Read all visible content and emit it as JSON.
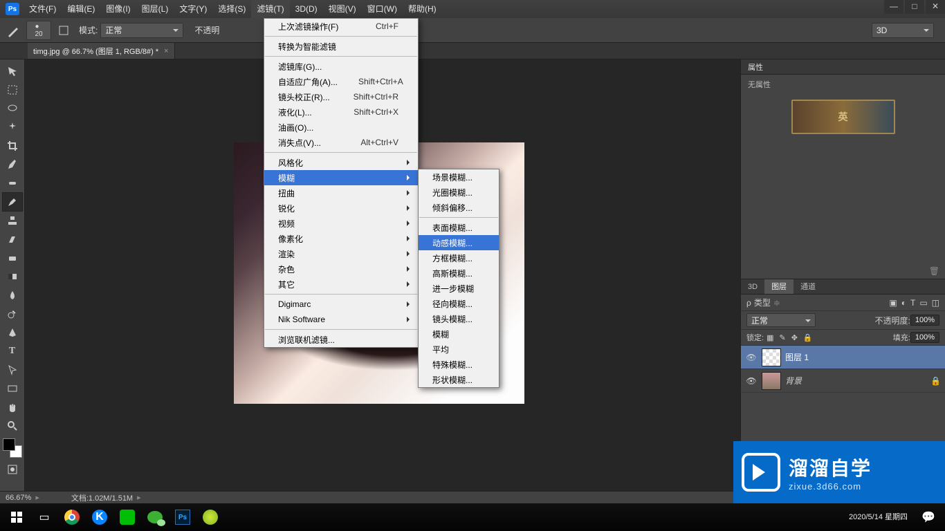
{
  "menubar": {
    "items": [
      "文件(F)",
      "编辑(E)",
      "图像(I)",
      "图层(L)",
      "文字(Y)",
      "选择(S)",
      "滤镜(T)",
      "3D(D)",
      "视图(V)",
      "窗口(W)",
      "帮助(H)"
    ],
    "open_index": 6
  },
  "window_controls": {
    "minimize": "—",
    "maximize": "□",
    "close": "✕"
  },
  "optionbar": {
    "brush_size_label": "20",
    "mode_label": "模式:",
    "mode_value": "正常",
    "opacity_label": "不透明",
    "right_select": "3D"
  },
  "doc_tab": {
    "label": "timg.jpg @ 66.7% (图层 1, RGB/8#) *"
  },
  "filter_menu": {
    "last": {
      "label": "上次滤镜操作(F)",
      "shortcut": "Ctrl+F"
    },
    "convert": {
      "label": "转换为智能滤镜"
    },
    "gallery": {
      "label": "滤镜库(G)..."
    },
    "adaptive": {
      "label": "自适应广角(A)...",
      "shortcut": "Shift+Ctrl+A"
    },
    "lens": {
      "label": "镜头校正(R)...",
      "shortcut": "Shift+Ctrl+R"
    },
    "liquify": {
      "label": "液化(L)...",
      "shortcut": "Shift+Ctrl+X"
    },
    "oil": {
      "label": "油画(O)..."
    },
    "vanish": {
      "label": "消失点(V)...",
      "shortcut": "Alt+Ctrl+V"
    },
    "stylize": {
      "label": "风格化"
    },
    "blur": {
      "label": "模糊"
    },
    "distort": {
      "label": "扭曲"
    },
    "sharpen": {
      "label": "锐化"
    },
    "video": {
      "label": "视频"
    },
    "pixelate": {
      "label": "像素化"
    },
    "render": {
      "label": "渲染"
    },
    "noise": {
      "label": "杂色"
    },
    "other": {
      "label": "其它"
    },
    "digimarc": {
      "label": "Digimarc"
    },
    "nik": {
      "label": "Nik Software"
    },
    "browse": {
      "label": "浏览联机滤镜..."
    }
  },
  "blur_submenu": {
    "items": [
      {
        "label": "场景模糊..."
      },
      {
        "label": "光圈模糊..."
      },
      {
        "label": "倾斜偏移..."
      },
      {
        "label": "表面模糊..."
      },
      {
        "label": "动感模糊...",
        "hl": true
      },
      {
        "label": "方框模糊..."
      },
      {
        "label": "高斯模糊..."
      },
      {
        "label": "进一步模糊"
      },
      {
        "label": "径向模糊..."
      },
      {
        "label": "镜头模糊..."
      },
      {
        "label": "模糊"
      },
      {
        "label": "平均"
      },
      {
        "label": "特殊模糊..."
      },
      {
        "label": "形状模糊..."
      }
    ],
    "sep_after": 2
  },
  "properties_panel": {
    "tab": "属性",
    "text": "无属性",
    "thumb_label": "英"
  },
  "layers_panel": {
    "tabs": {
      "d3": "3D",
      "layers": "图层",
      "channels": "通道"
    },
    "kind_label": "类型",
    "blend_value": "正常",
    "opacity_label": "不透明度:",
    "opacity_value": "100%",
    "lock_label": "锁定:",
    "fill_label": "填充:",
    "fill_value": "100%",
    "layer1": "图层 1",
    "background": "背景"
  },
  "tools": [
    "move",
    "marquee",
    "lasso",
    "wand",
    "crop",
    "eyedrop",
    "heal",
    "brush",
    "stamp",
    "history",
    "eraser",
    "gradient",
    "blur",
    "dodge",
    "pen",
    "type",
    "path",
    "rect",
    "hand",
    "zoom"
  ],
  "statusbar": {
    "zoom": "66.67%",
    "doc": "文档:1.02M/1.51M"
  },
  "brand": {
    "main": "溜溜自学",
    "sub": "zixue.3d66.com"
  },
  "taskbar": {
    "date": "2020/5/14 星期四"
  },
  "rabbit": "(\\_/)"
}
